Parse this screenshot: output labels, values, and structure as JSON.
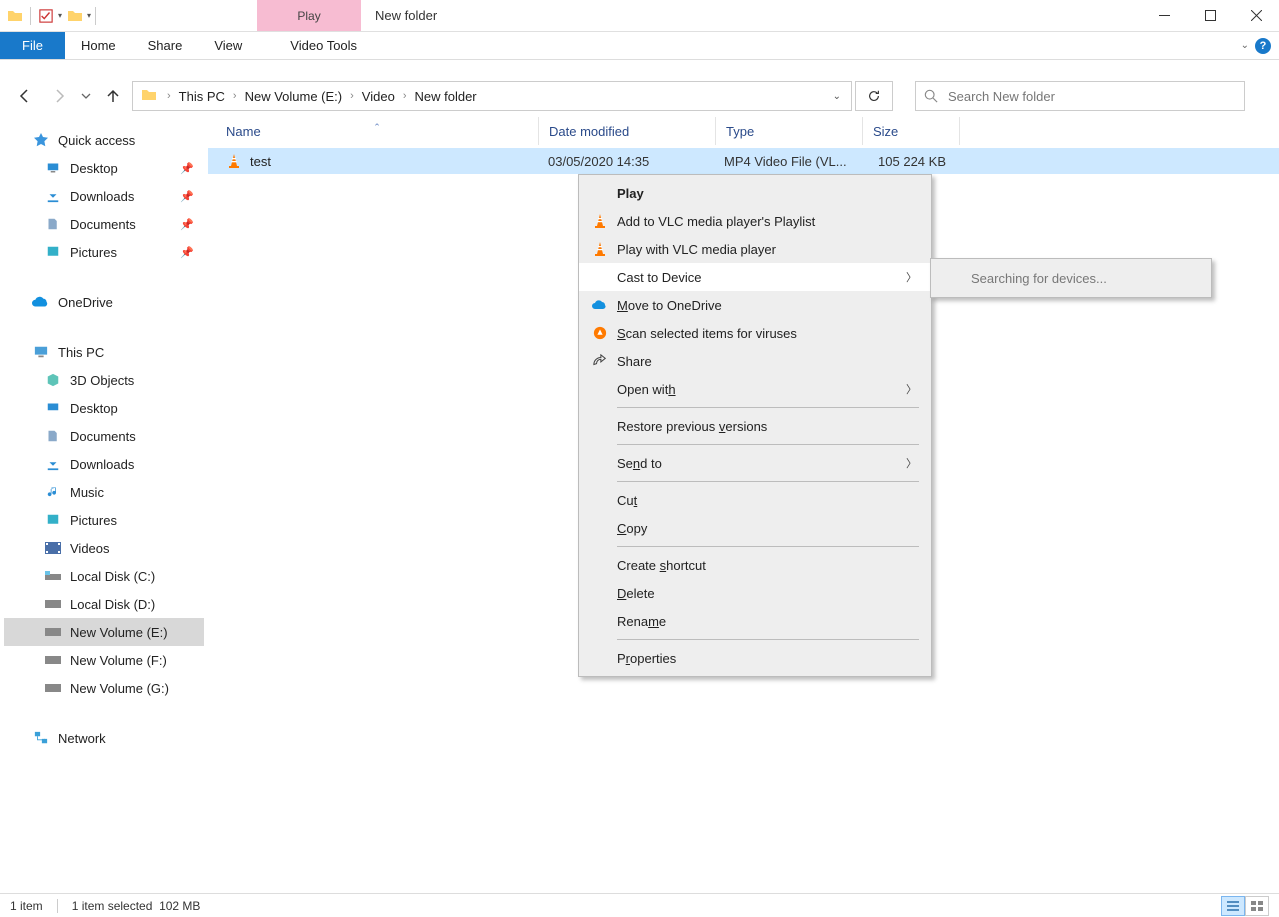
{
  "window_title": "New folder",
  "contextual_tab_upper": "Play",
  "ribbon": {
    "file": "File",
    "home": "Home",
    "share": "Share",
    "view": "View",
    "video_tools": "Video Tools"
  },
  "breadcrumbs": [
    "This PC",
    "New Volume (E:)",
    "Video",
    "New folder"
  ],
  "search_placeholder": "Search New folder",
  "columns": {
    "name": "Name",
    "date": "Date modified",
    "type": "Type",
    "size": "Size"
  },
  "file": {
    "name": "test",
    "date": "03/05/2020 14:35",
    "type": "MP4 Video File (VL...",
    "size": "105 224 KB"
  },
  "sidebar": {
    "quick_access": "Quick access",
    "desktop": "Desktop",
    "downloads": "Downloads",
    "documents": "Documents",
    "pictures": "Pictures",
    "onedrive": "OneDrive",
    "this_pc": "This PC",
    "objects3d": "3D Objects",
    "music": "Music",
    "videos": "Videos",
    "local_c": "Local Disk (C:)",
    "local_d": "Local Disk (D:)",
    "vol_e": "New Volume (E:)",
    "vol_f": "New Volume (F:)",
    "vol_g": "New Volume (G:)",
    "network": "Network"
  },
  "context_menu": {
    "play": "Play",
    "add_vlc": "Add to VLC media player's Playlist",
    "play_vlc": "Play with VLC media player",
    "cast": "Cast to Device",
    "move_onedrive": "Move to OneDrive",
    "scan": "Scan selected items for viruses",
    "share": "Share",
    "open_with": "Open with",
    "restore": "Restore previous versions",
    "send_to": "Send to",
    "cut": "Cut",
    "copy": "Copy",
    "shortcut": "Create shortcut",
    "delete": "Delete",
    "rename": "Rename",
    "properties": "Properties"
  },
  "submenu_searching": "Searching for devices...",
  "status": {
    "count": "1 item",
    "selected": "1 item selected",
    "size": "102 MB"
  }
}
